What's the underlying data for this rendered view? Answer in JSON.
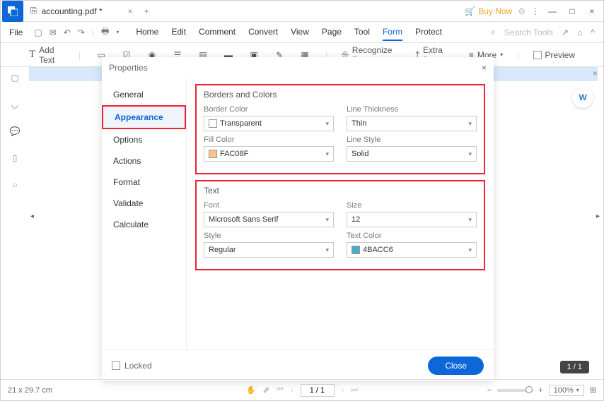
{
  "title_bar": {
    "tab_name": "accounting.pdf *",
    "buy_now": "Buy Now"
  },
  "menu": {
    "file": "File",
    "tabs": [
      "Home",
      "Edit",
      "Comment",
      "Convert",
      "View",
      "Page",
      "Tool",
      "Form",
      "Protect"
    ],
    "active_tab": "Form",
    "search_placeholder": "Search Tools"
  },
  "toolbar": {
    "add_text": "Add Text",
    "recognize": "Recognize Form",
    "extra_data": "Extra Data",
    "more": "More",
    "preview": "Preview"
  },
  "properties": {
    "title": "Properties",
    "sidebar": [
      "General",
      "Appearance",
      "Options",
      "Actions",
      "Format",
      "Validate",
      "Calculate"
    ],
    "active": "Appearance",
    "borders_colors": {
      "title": "Borders and Colors",
      "border_color_label": "Border Color",
      "border_color_value": "Transparent",
      "line_thickness_label": "Line Thickness",
      "line_thickness_value": "Thin",
      "fill_color_label": "Fill Color",
      "fill_color_value": "FAC08F",
      "fill_color_hex": "#FAC08F",
      "line_style_label": "Line Style",
      "line_style_value": "Solid"
    },
    "text": {
      "title": "Text",
      "font_label": "Font",
      "font_value": "Microsoft Sans Serif",
      "size_label": "Size",
      "size_value": "12",
      "style_label": "Style",
      "style_value": "Regular",
      "text_color_label": "Text Color",
      "text_color_value": "4BACC6",
      "text_color_hex": "#4BACC6"
    },
    "locked": "Locked",
    "close": "Close"
  },
  "status": {
    "dimensions": "21 x 29.7 cm",
    "page": "1 / 1",
    "page_badge": "1 / 1",
    "zoom": "100%"
  }
}
